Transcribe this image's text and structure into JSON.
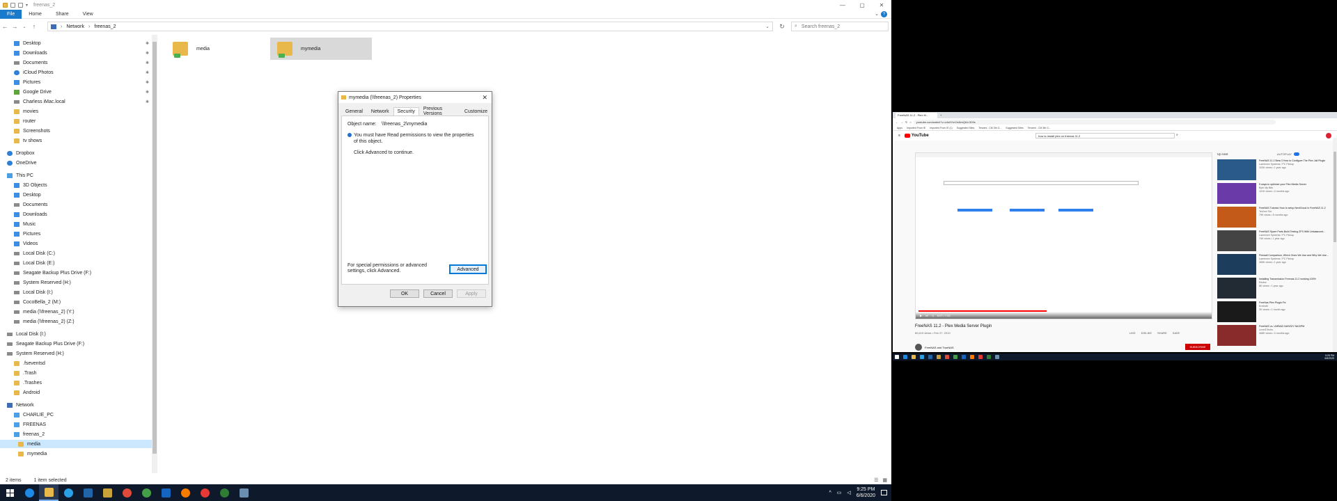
{
  "explorer": {
    "window_title": "freenas_2",
    "ribbon_tabs": [
      "File",
      "Home",
      "Share",
      "View"
    ],
    "path": [
      "Network",
      "freenas_2"
    ],
    "search_placeholder": "Search freenas_2",
    "nav_items": [
      {
        "label": "Desktop",
        "icon": "desktop-icon",
        "pinned": true
      },
      {
        "label": "Downloads",
        "icon": "downloads-icon",
        "pinned": true
      },
      {
        "label": "Documents",
        "icon": "documents-icon",
        "pinned": true
      },
      {
        "label": "iCloud Photos",
        "icon": "icloud-icon",
        "pinned": true
      },
      {
        "label": "Pictures",
        "icon": "pictures-icon",
        "pinned": true
      },
      {
        "label": "Google Drive",
        "icon": "google-drive-icon",
        "pinned": true
      },
      {
        "label": "Charless iMac.local",
        "icon": "network-drive-icon",
        "pinned": true
      },
      {
        "label": "movies",
        "icon": "folder-icon"
      },
      {
        "label": "router",
        "icon": "folder-icon"
      },
      {
        "label": "Screenshots",
        "icon": "folder-icon"
      },
      {
        "label": "tv shows",
        "icon": "folder-icon"
      },
      {
        "label": "Dropbox",
        "icon": "dropbox-icon"
      },
      {
        "label": "OneDrive",
        "icon": "onedrive-icon"
      },
      {
        "label": "This PC",
        "icon": "this-pc-icon"
      },
      {
        "label": "3D Objects",
        "icon": "3d-objects-icon"
      },
      {
        "label": "Desktop",
        "icon": "desktop-icon"
      },
      {
        "label": "Documents",
        "icon": "documents-icon"
      },
      {
        "label": "Downloads",
        "icon": "downloads-icon"
      },
      {
        "label": "Music",
        "icon": "music-icon"
      },
      {
        "label": "Pictures",
        "icon": "pictures-icon"
      },
      {
        "label": "Videos",
        "icon": "videos-icon"
      },
      {
        "label": "Local Disk (C:)",
        "icon": "drive-icon"
      },
      {
        "label": "Local Disk (E:)",
        "icon": "drive-icon"
      },
      {
        "label": "Seagate Backup Plus Drive (F:)",
        "icon": "drive-icon"
      },
      {
        "label": "System Reserved (H:)",
        "icon": "drive-icon"
      },
      {
        "label": "Local Disk (I:)",
        "icon": "drive-icon"
      },
      {
        "label": "CocoBella_2 (M:)",
        "icon": "drive-icon"
      },
      {
        "label": "media (\\\\freenas_2) (Y:)",
        "icon": "network-drive-icon"
      },
      {
        "label": "media (\\\\freenas_2) (Z:)",
        "icon": "network-drive-icon"
      },
      {
        "label": "Local Disk (I:)",
        "icon": "drive-icon"
      },
      {
        "label": "Seagate Backup Plus Drive (F:)",
        "icon": "drive-icon"
      },
      {
        "label": "System Reserved (H:)",
        "icon": "drive-icon"
      },
      {
        "label": ".fseventsd",
        "icon": "folder-icon"
      },
      {
        "label": ".Trash",
        "icon": "folder-icon"
      },
      {
        "label": ".Trashes",
        "icon": "folder-icon"
      },
      {
        "label": "Android",
        "icon": "folder-icon"
      },
      {
        "label": "Network",
        "icon": "network-icon"
      },
      {
        "label": "CHARLIE_PC",
        "icon": "computer-icon"
      },
      {
        "label": "FREENAS",
        "icon": "computer-icon"
      },
      {
        "label": "freenas_2",
        "icon": "computer-icon"
      },
      {
        "label": "media",
        "icon": "share-folder-icon",
        "selected": true
      },
      {
        "label": "mymedia",
        "icon": "share-folder-icon"
      }
    ],
    "files": [
      {
        "label": "media"
      },
      {
        "label": "mymedia",
        "selected": true
      }
    ],
    "status": {
      "count": "2 items",
      "selection": "1 item selected"
    }
  },
  "dialog": {
    "title": "mymedia (\\\\freenas_2) Properties",
    "tabs": [
      "General",
      "Network",
      "Security",
      "Previous Versions",
      "Customize"
    ],
    "active_tab": "Security",
    "object_name_label": "Object name:",
    "object_name_value": "\\\\freenas_2\\mymedia",
    "message": "You must have Read permissions to view the properties of this object.",
    "advanced_hint": "Click Advanced to continue.",
    "special_text": "For special permissions or advanced settings, click Advanced.",
    "advanced_button": "Advanced",
    "ok": "OK",
    "cancel": "Cancel",
    "apply": "Apply"
  },
  "taskbar": {
    "time": "9:25 PM",
    "date": "6/6/2020"
  },
  "browser": {
    "tab_title": "FreeNAS 11.2 - Plex M...",
    "url": "youtube.com/watch?v=c4n6YmOsNmQ&t=309s",
    "bookmarks": [
      "Apps",
      "Imported From IE",
      "Imported From IE (1)",
      "Suggested Sites",
      "Tenzeni - CM 3th G...",
      "Suggested Sites",
      "Tenzeni - CM 3th G..."
    ],
    "yt_search": "how to install plex on freenas 11.2",
    "video_title": "FreeNAS 11.2 - Plex Media Server Plugin",
    "video_meta": "89,619 views • Feb 27, 2019",
    "time_display": "6:07 / 7:52",
    "progress_fraction": 0.44,
    "actions": [
      "LIKE",
      "DISLIKE",
      "SHARE",
      "SAVE"
    ],
    "channel": "FreeNAS and TrueNAS",
    "subscribe": "SUBSCRIBE",
    "up_next": "Up next",
    "autoplay": "AUTOPLAY",
    "recommendations": [
      {
        "title": "FreeNAS 11.2 Beta 3 How to Configure The Plex Jail Plugin",
        "sub": "Lawrence Systems / PC Pickup",
        "views": "103K views • 1 year ago",
        "color": "#2a5a8a"
      },
      {
        "title": "5 ways to optimize your Plex Media Server",
        "sub": "Byte My Bits",
        "views": "101K views • 4 months ago",
        "color": "#6a3aa8"
      },
      {
        "title": "FreeNAS Tutorial: How to setup NextCloud in FreeNAS 11.2",
        "sub": "Techno Tim",
        "views": "79K views • 8 months ago",
        "color": "#c35a1a"
      },
      {
        "title": "FreeNAS Spare Parts Build Testing ZFS With Unbalanced...",
        "sub": "Lawrence Systems / PC Pickup",
        "views": "74K views • 1 year ago",
        "color": "#444"
      },
      {
        "title": "Firewall Comparison, Which Ones We Use and Why We Use...",
        "sub": "Lawrence Systems / PC Pickup",
        "views": "265K views • 1 year ago",
        "color": "#1d3d5c"
      },
      {
        "title": "Installing Transmission Freenas 11.2 working 100%",
        "sub": "Redmi",
        "views": "8K views • 1 year ago",
        "color": "#222a33"
      },
      {
        "title": "FreeNas Plex Plugin Fix",
        "sub": "Eretrofit",
        "views": "2K views • 1 month ago",
        "color": "#1a1a1a"
      },
      {
        "title": "FreeNAS vs. UNRAID NAS/DIY NAS/PM",
        "sub": "Level1Techs",
        "views": "468K views • 4 months ago",
        "color": "#8a2b2b"
      }
    ],
    "r_time": "9:25 PM",
    "r_date": "6/6/2020"
  }
}
